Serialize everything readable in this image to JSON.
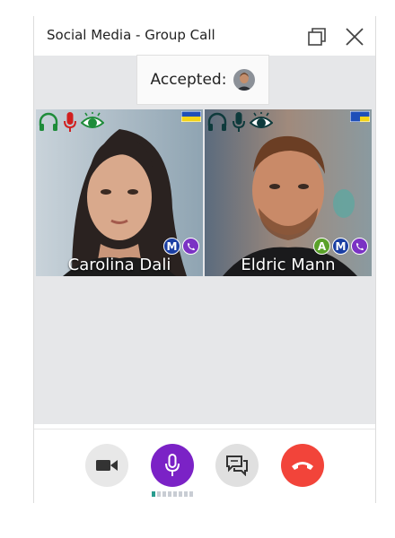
{
  "window": {
    "title": "Social Media - Group Call"
  },
  "accepted": {
    "label": "Accepted:"
  },
  "participants": [
    {
      "name": "Carolina Dali",
      "badges": [
        "M",
        "viber"
      ]
    },
    {
      "name": "Eldric Mann",
      "badges": [
        "A",
        "M",
        "viber"
      ]
    }
  ],
  "colors": {
    "mic_active": "#7b22c6",
    "hangup": "#f2443a",
    "badge_m": "#1b3fa3",
    "badge_a": "#5aa12a",
    "badge_viber": "#7b32c4"
  },
  "controls": {
    "video": "video-camera-icon",
    "mic": "microphone-icon",
    "chat": "chat-icon",
    "hangup": "phone-hangup-icon"
  },
  "mic_level": {
    "active_bars": 1,
    "total_bars": 8
  }
}
